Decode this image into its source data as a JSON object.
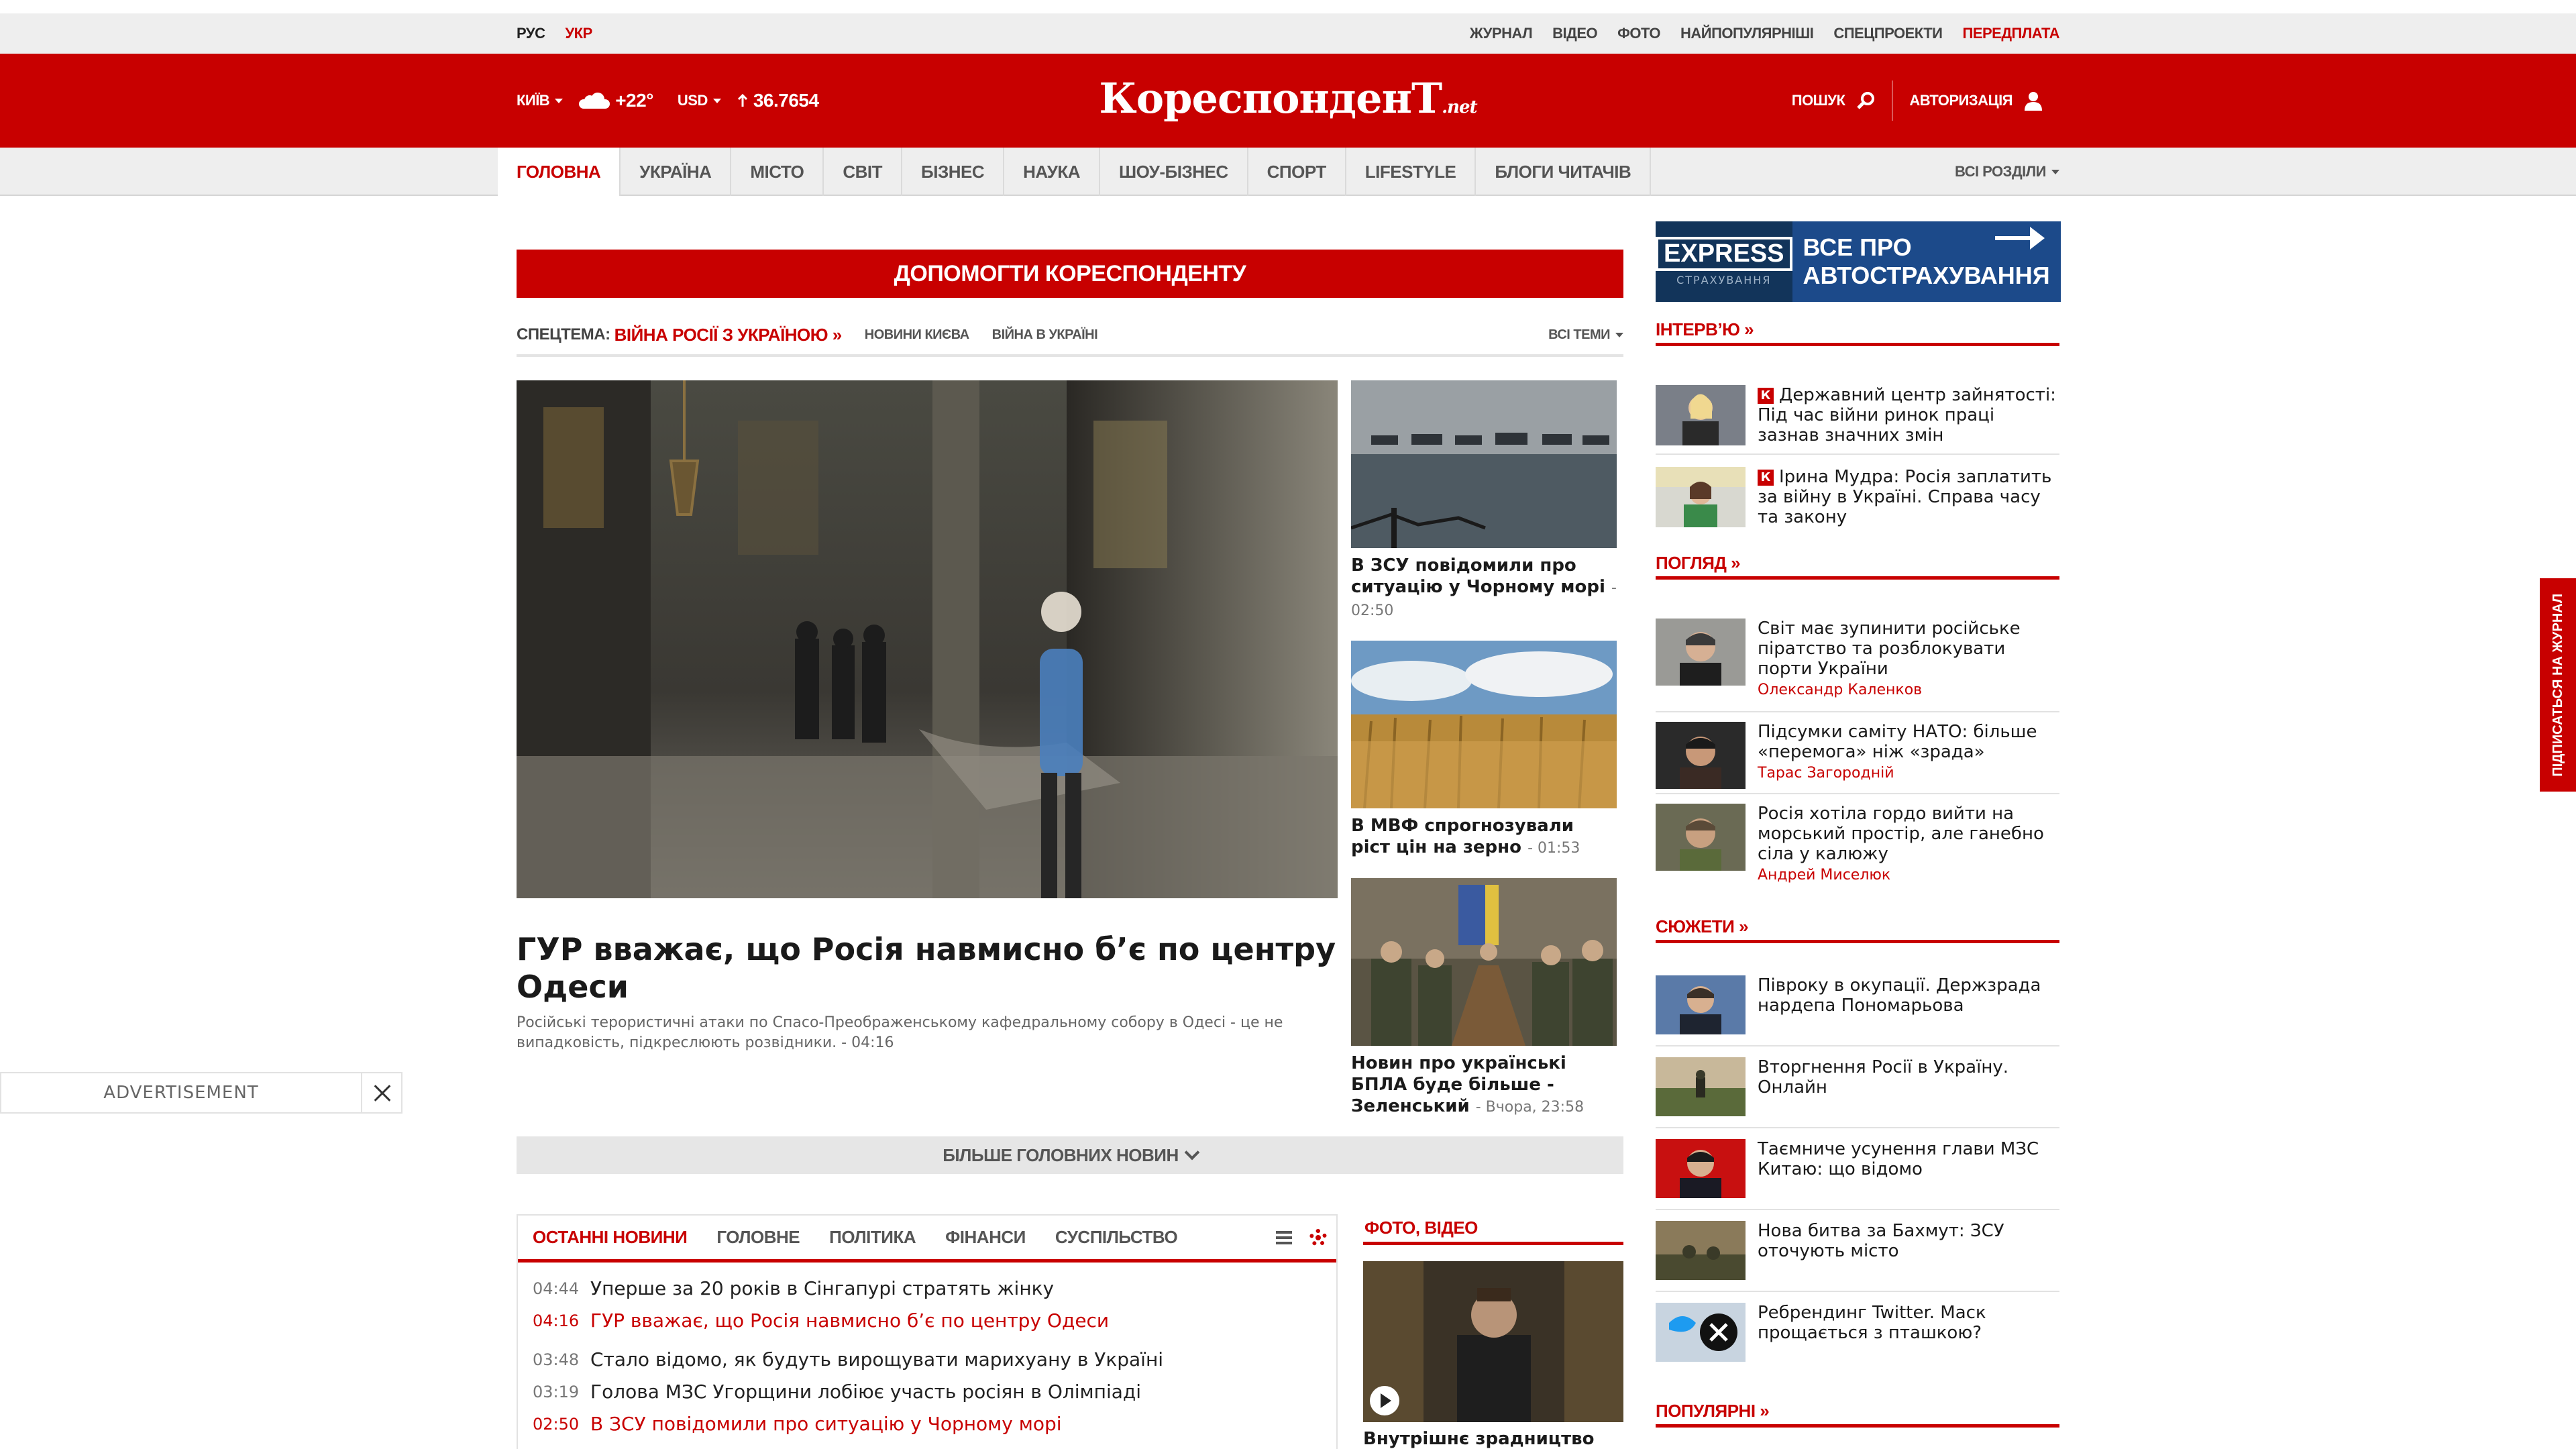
{
  "top_bar": {
    "languages": [
      "РУС",
      "УКР"
    ],
    "links": [
      "ЖУРНАЛ",
      "ВІДЕО",
      "ФОТО",
      "НАЙПОПУЛЯРНІШІ",
      "СПЕЦПРОЕКТИ",
      "ПЕРЕДПЛАТА"
    ]
  },
  "header": {
    "city": "КИЇВ",
    "temperature": "+22°",
    "currency": "USD",
    "rate": "36.7654",
    "logo": "КореспонденТ",
    "logo_suffix": ".net",
    "search_label": "ПОШУК",
    "auth_label": "АВТОРИЗАЦІЯ",
    "colors": {
      "brand_red": "#c80000"
    }
  },
  "nav": {
    "tabs": [
      "ГОЛОВНА",
      "УКРАЇНА",
      "МІСТО",
      "СВІТ",
      "БІЗНЕС",
      "НАУКА",
      "ШОУ-БІЗНЕС",
      "СПОРТ",
      "LIFESTYLE",
      "БЛОГИ ЧИТАЧІВ"
    ],
    "all_sections": "ВСІ РОЗДІЛИ"
  },
  "main": {
    "help_banner": "ДОПОМОГТИ КОРЕСПОНДЕНТУ",
    "spec_label": "СПЕЦТЕМА:",
    "spec_war": "ВІЙНА РОСІЇ З УКРАЇНОЮ »",
    "spec_tags": [
      "НОВИНИ КИЄВА",
      "ВІЙНА В УКРАЇНІ"
    ],
    "all_topics": "ВСІ ТЕМИ",
    "hero": {
      "title": "ГУР вважає, що Росія навмисно б’є по центру Одеси",
      "description": "Російські терористичні атаки по Спасо-Преображенському кафедральному собору в Одесі - це не випадковість, підкреслюють розвідники.",
      "time": "- 04:16"
    },
    "side_news": [
      {
        "title": "В ЗСУ повідомили про ситуацію у Чорному морі",
        "time": "- 02:50"
      },
      {
        "title": "В МВФ спрогнозували ріст цін на зерно",
        "time": "- 01:53"
      },
      {
        "title": "Новин про українські БПЛА буде більше - Зеленський",
        "time": "- Вчора, 23:58"
      }
    ],
    "more_label": "БІЛЬШЕ ГОЛОВНИХ НОВИН",
    "latest": {
      "tabs": [
        "ОСТАННІ НОВИНИ",
        "ГОЛОВНЕ",
        "ПОЛІТИКА",
        "ФІНАНСИ",
        "СУСПІЛЬСТВО"
      ],
      "items": [
        {
          "time": "04:44",
          "title": "Уперше за 20 років в Сінгапурі стратять жінку"
        },
        {
          "time": "04:16",
          "title": "ГУР вважає, що Росія навмисно б’є по центру Одеси"
        },
        {
          "time": "03:48",
          "title": "Стало відомо, як будуть вирощувати марихуану в Україні"
        },
        {
          "time": "03:19",
          "title": "Голова МЗС Угорщини лобіює участь росіян в Олімпіаді"
        },
        {
          "time": "02:50",
          "title": "В ЗСУ повідомили про ситуацію у Чорному морі"
        }
      ]
    },
    "photo_video": {
      "heading": "ФОТО, ВІДЕО",
      "caption": "Внутрішнє зрадництво"
    }
  },
  "sidebar": {
    "ad": {
      "brand": "EXPRESS",
      "brand_sub": "СТРАХУВАННЯ",
      "line1": "ВСЕ ПРО",
      "line2": "АВТОСТРАХУВАННЯ"
    },
    "interview": {
      "heading": "ІНТЕРВ’Ю »",
      "items": [
        {
          "title": "Державний центр зайнятості: Під час війни ринок праці зазнав значних змін"
        },
        {
          "title": "Ірина Мудра: Росія заплатить за війну в Україні. Справа часу та закону"
        }
      ]
    },
    "opinion": {
      "heading": "ПОГЛЯД »",
      "items": [
        {
          "title": "Світ має зупинити російське піратство та розблокувати порти України",
          "author": "Олександр Каленков"
        },
        {
          "title": "Підсумки саміту НАТО: більше «перемога» ніж «зрада»",
          "author": "Тарас Загородній"
        },
        {
          "title": "Росія хотіла гордо вийти на морський простір, але ганебно сіла у калюжу",
          "author": "Андрей Миселюк"
        }
      ]
    },
    "stories": {
      "heading": "СЮЖЕТИ »",
      "items": [
        {
          "title": "Півроку в окупації. Держзрада нардепа Пономарьова"
        },
        {
          "title": "Вторгнення Росії в Україну. Онлайн"
        },
        {
          "title": "Таємниче усунення глави МЗС Китаю: що відомо"
        },
        {
          "title": "Нова битва за Бахмут: ЗСУ оточують місто"
        },
        {
          "title": "Ребрендинг Twitter. Маск прощається з пташкою?"
        }
      ]
    },
    "popular": {
      "heading": "ПОПУЛЯРНІ »"
    }
  },
  "advertisement": {
    "label": "ADVERTISEMENT"
  },
  "subscribe": {
    "label": "ПІДПИСАТЬСЯ НА ЖУРНАЛ"
  }
}
